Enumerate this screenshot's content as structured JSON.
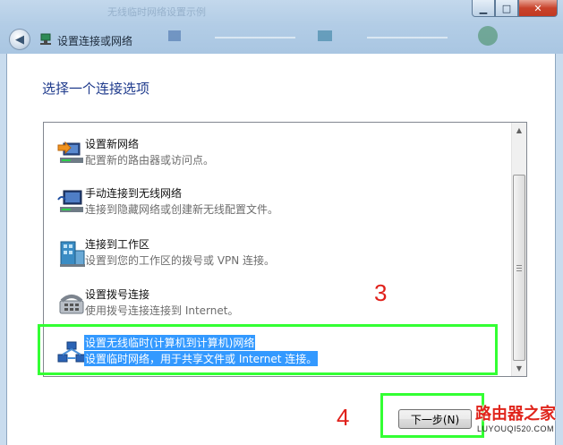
{
  "window": {
    "title_ghost": "无线临时网络设置示例",
    "caption": {
      "minimize": "▁",
      "maximize": "□",
      "close": "✕"
    }
  },
  "nav": {
    "back_glyph": "◀",
    "title": "设置连接或网络"
  },
  "heading": "选择一个连接选项",
  "options": [
    {
      "icon": "network-setup-icon",
      "title": "设置新网络",
      "desc": "配置新的路由器或访问点。"
    },
    {
      "icon": "wireless-manual-icon",
      "title": "手动连接到无线网络",
      "desc": "连接到隐藏网络或创建新无线配置文件。"
    },
    {
      "icon": "workplace-icon",
      "title": "连接到工作区",
      "desc": "设置到您的工作区的拨号或 VPN 连接。"
    },
    {
      "icon": "dialup-modem-icon",
      "title": "设置拨号连接",
      "desc": "使用拨号连接连接到 Internet。"
    },
    {
      "icon": "adhoc-network-icon",
      "title": "设置无线临时(计算机到计算机)网络",
      "desc": "设置临时网络，用于共享文件或 Internet 连接。",
      "selected": true
    }
  ],
  "annotations": {
    "step3": "3",
    "step4": "4",
    "highlight_color": "#33ff33",
    "number_color": "#e0201a"
  },
  "next_button": "下一步(N)",
  "watermark": {
    "line1": "路由器之家",
    "line2": "LUYOUQI520.COM"
  }
}
